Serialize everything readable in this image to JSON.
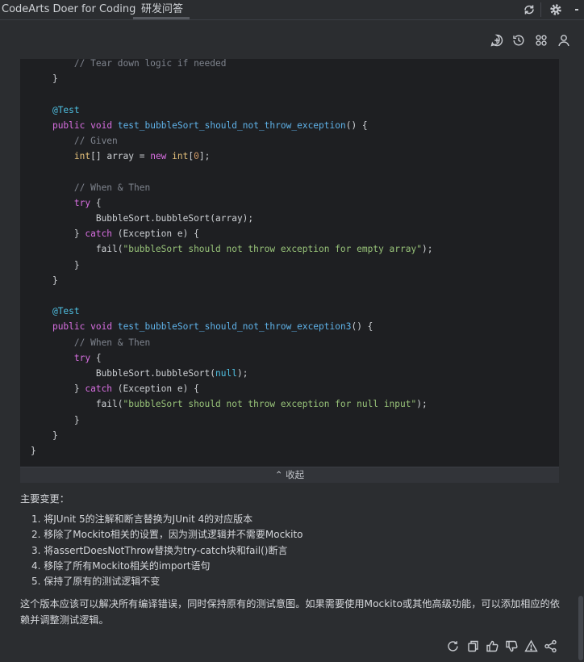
{
  "tabs": [
    {
      "label": "CodeArts Doer for Coding"
    },
    {
      "label": "研发问答"
    }
  ],
  "top_icons": [
    "refresh-icon",
    "gear-icon"
  ],
  "toolbar_icons": [
    "new-chat-icon",
    "history-icon",
    "apps-icon",
    "user-icon"
  ],
  "code": {
    "lines": [
      "        // Tear down logic if needed",
      "    }",
      "",
      "    @Test",
      "    public void test_bubbleSort_should_not_throw_exception() {",
      "        // Given",
      "        int[] array = new int[0];",
      "",
      "        // When & Then",
      "        try {",
      "            BubbleSort.bubbleSort(array);",
      "        } catch (Exception e) {",
      "            fail(\"bubbleSort should not throw exception for empty array\");",
      "        }",
      "    }",
      "",
      "    @Test",
      "    public void test_bubbleSort_should_not_throw_exception3() {",
      "        // When & Then",
      "        try {",
      "            BubbleSort.bubbleSort(null);",
      "        } catch (Exception e) {",
      "            fail(\"bubbleSort should not throw exception for null input\");",
      "        }",
      "    }",
      "}"
    ],
    "collapse_label": "收起"
  },
  "summary": {
    "title": "主要变更：",
    "items": [
      "1. 将JUnit 5的注解和断言替换为JUnit 4的对应版本",
      "2. 移除了Mockito相关的设置，因为测试逻辑并不需要Mockito",
      "3. 将assertDoesNotThrow替换为try-catch块和fail()断言",
      "4. 移除了所有Mockito相关的import语句",
      "5. 保持了原有的测试逻辑不变"
    ],
    "conclusion": "这个版本应该可以解决所有编译错误，同时保持原有的测试意图。如果需要使用Mockito或其他高级功能，可以添加相应的依赖并调整测试逻辑。"
  },
  "action_icons": [
    "regenerate-icon",
    "copy-icon",
    "thumbs-up-icon",
    "thumbs-down-icon",
    "warning-icon",
    "share-icon"
  ]
}
